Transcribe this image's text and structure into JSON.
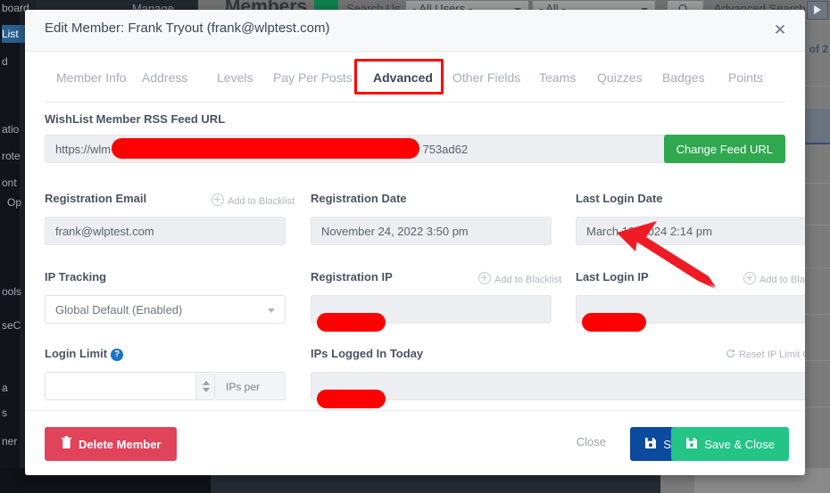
{
  "background": {
    "top_bar": {
      "manage_label": "Manage",
      "members_title": "Members",
      "add_label": "+",
      "search_label": "Search Us",
      "user_filter": "- All Users -",
      "level_filter": "- All -",
      "search_icon": "magnifier-icon",
      "advanced_search": "Advanced Search"
    },
    "admin_menu": [
      "board",
      "List",
      "d",
      "atio",
      "rote",
      "ont",
      "Op",
      "ools",
      "seC",
      "a",
      "s",
      "ner"
    ],
    "pagination_text": "of 2"
  },
  "modal": {
    "title": "Edit Member: Frank Tryout (frank@wlptest.com)",
    "close_icon": "close-icon",
    "tabs": [
      {
        "label": "Member Info",
        "active": false
      },
      {
        "label": "Address",
        "active": false
      },
      {
        "label": "Levels",
        "active": false
      },
      {
        "label": "Pay Per Posts",
        "active": false
      },
      {
        "label": "Advanced",
        "active": true
      },
      {
        "label": "Other Fields",
        "active": false
      },
      {
        "label": "Teams",
        "active": false
      },
      {
        "label": "Quizzes",
        "active": false
      },
      {
        "label": "Badges",
        "active": false
      },
      {
        "label": "Points",
        "active": false
      }
    ],
    "rss": {
      "label": "WishList Member RSS Feed URL",
      "value_prefix": "https://wlm-",
      "value_suffix": "753ad62",
      "change_button": "Change Feed URL"
    },
    "registration_email": {
      "label": "Registration Email",
      "value": "frank@wlptest.com",
      "blacklist_label": "Add to Blacklist",
      "blacklist_icon": "plus-circle-icon"
    },
    "registration_date": {
      "label": "Registration Date",
      "value": "November 24, 2022 3:50 pm"
    },
    "last_login_date": {
      "label": "Last Login Date",
      "value": "March 18, 2024 2:14 pm"
    },
    "ip_tracking": {
      "label": "IP Tracking",
      "value": "Global Default (Enabled)",
      "caret_icon": "chevron-down-icon"
    },
    "registration_ip": {
      "label": "Registration IP",
      "value": "",
      "blacklist_label": "Add to Blacklist",
      "blacklist_icon": "plus-circle-icon"
    },
    "last_login_ip": {
      "label": "Last Login IP",
      "value": "",
      "blacklist_label": "Add to Blacklist",
      "blacklist_icon": "plus-circle-icon"
    },
    "login_limit": {
      "label": "Login Limit",
      "help_icon": "question-mark-icon",
      "help_glyph": "?",
      "value": "",
      "placeholder": "",
      "suffix": "IPs per day",
      "stepper_icon": "spinner-icon"
    },
    "ips_logged_in_today": {
      "label": "IPs Logged In Today",
      "value": "",
      "reset_label": "Reset IP Limit Counter",
      "reset_icon": "refresh-icon"
    },
    "footer": {
      "delete_label": "Delete Member",
      "delete_icon": "trash-icon",
      "close_label": "Close",
      "save_label": "Save",
      "save_icon": "floppy-disk-icon",
      "save_close_label": "Save & Close",
      "save_close_icon": "floppy-disk-icon"
    }
  },
  "annotations": {
    "tab_highlight_color": "#ff0000",
    "arrow_color": "#ee1b24",
    "arrow_target": "last_login_date",
    "redaction_color": "#fe0000"
  }
}
